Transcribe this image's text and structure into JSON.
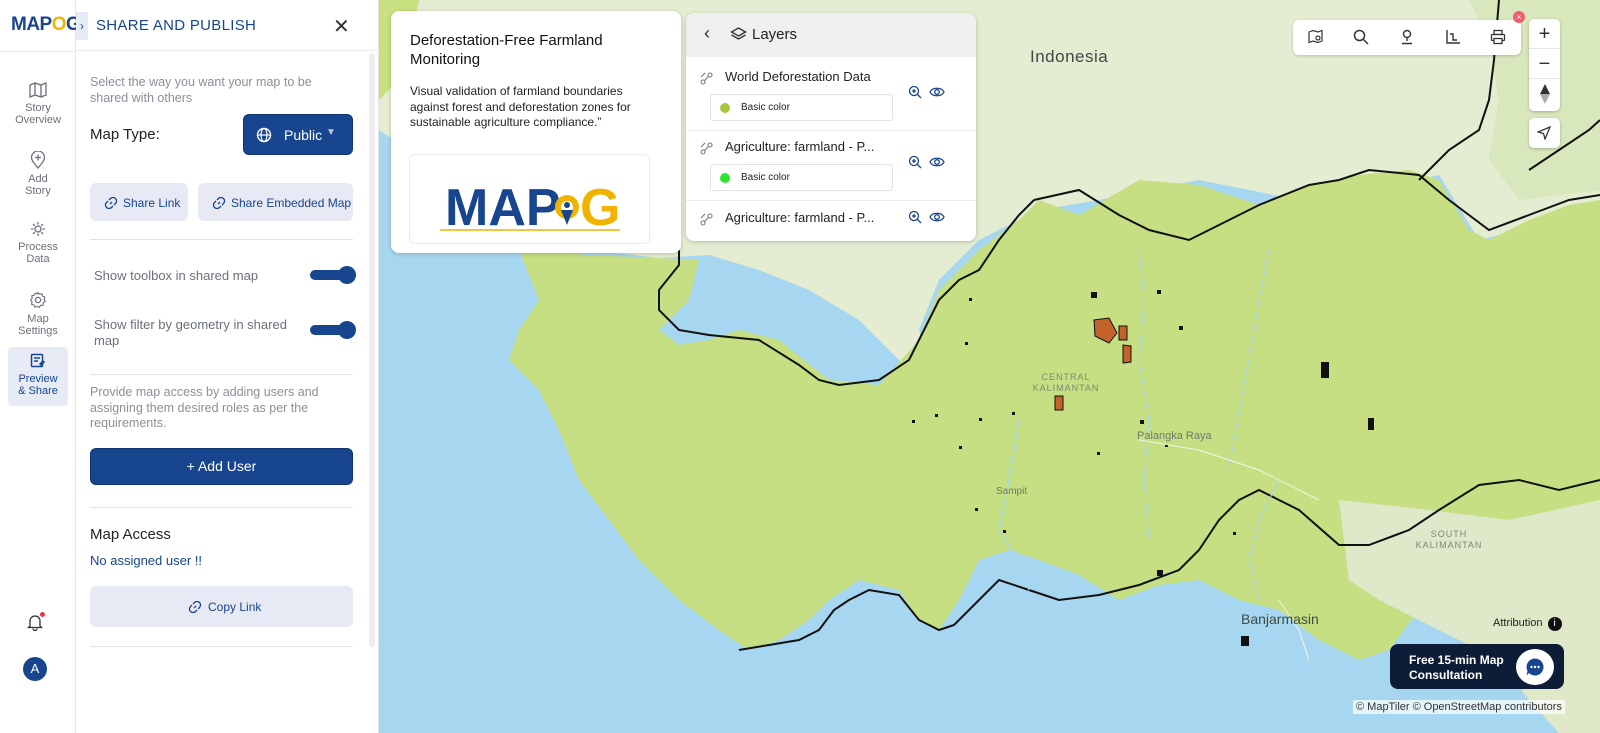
{
  "colors": {
    "brand": "#17458e",
    "accent": "#f0b400",
    "land_green": "#c9e080",
    "neighbor_land": "#dfe8c9",
    "water": "#a7d6f0",
    "deforestation": "#c4622c"
  },
  "logo": {
    "prefix": "MAP",
    "o": "O",
    "suffix": "G"
  },
  "rail": {
    "items": [
      {
        "label": "Story\nOverview",
        "icon": "map-icon"
      },
      {
        "label": "Add\nStory",
        "icon": "add-pin-icon"
      },
      {
        "label": "Process\nData",
        "icon": "gear-cog-icon"
      },
      {
        "label": "Map\nSettings",
        "icon": "settings-icon"
      },
      {
        "label": "Preview\n& Share",
        "icon": "preview-share-icon",
        "active": true
      }
    ],
    "avatar_initial": "A"
  },
  "panel": {
    "title": "SHARE AND PUBLISH",
    "intro": "Select the way you want your map to be shared with others",
    "map_type_label": "Map Type:",
    "map_type_value": "Public",
    "share_link": "Share Link",
    "share_embedded": "Share Embedded Map",
    "toggle_toolbox": "Show toolbox in shared map",
    "toggle_filter": "Show filter by geometry in shared map",
    "access_desc": "Provide map access by adding users and assigning them desired roles as per the requirements.",
    "add_user": "+ Add User",
    "map_access_title": "Map Access",
    "no_user": "No assigned user !!",
    "copy_link": "Copy Link"
  },
  "info_card": {
    "title": "Deforestation-Free Farmland Monitoring",
    "description": "Visual validation of farmland boundaries against forest and deforestation zones for sustainable agriculture compliance.”",
    "logo": {
      "left": "MAP",
      "right": "G"
    }
  },
  "layers": {
    "title": "Layers",
    "items": [
      {
        "name": "World Deforestation Data",
        "color_label": "Basic color",
        "color": "#a8c83a"
      },
      {
        "name": "Agriculture: farmland - P...",
        "color_label": "Basic color",
        "color": "#2ee62e"
      },
      {
        "name": "Agriculture: farmland - P..."
      }
    ]
  },
  "map": {
    "country": "Indonesia",
    "region_central": "CENTRAL\nKALIMANTAN",
    "region_south": "SOUTH\nKALIMANTAN",
    "city_palangka": "Palangka Raya",
    "city_sampit": "Sampit",
    "city_banjarmasin": "Banjarmasin",
    "attribution": "Attribution",
    "copyright": "© MapTiler © OpenStreetMap contributors"
  },
  "consult": {
    "text": "Free 15-min Map\nConsultation"
  }
}
